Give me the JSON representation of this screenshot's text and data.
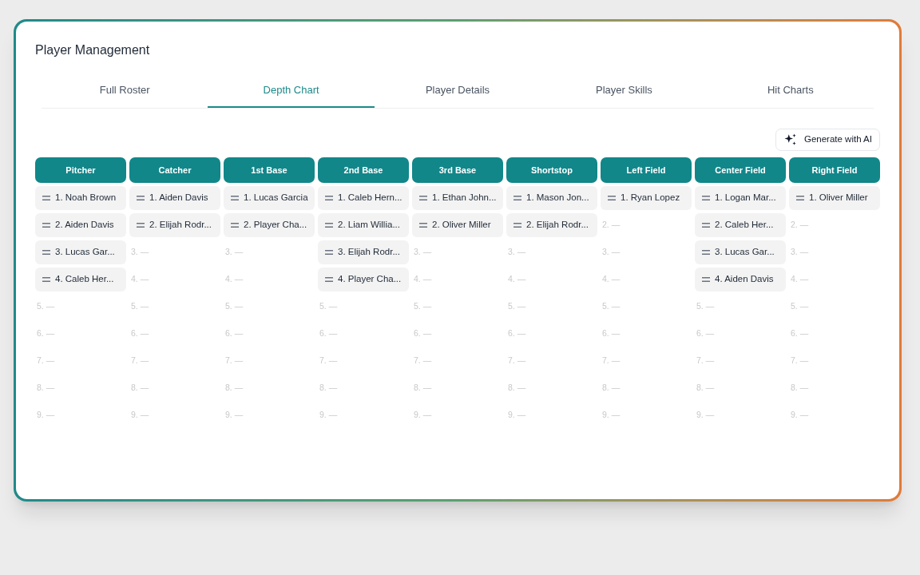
{
  "title": "Player Management",
  "tabs": [
    {
      "label": "Full Roster",
      "selected": false
    },
    {
      "label": "Depth Chart",
      "selected": true
    },
    {
      "label": "Player Details",
      "selected": false
    },
    {
      "label": "Player Skills",
      "selected": false
    },
    {
      "label": "Hit Charts",
      "selected": false
    }
  ],
  "generate_button": {
    "label": "Generate with AI"
  },
  "columns": [
    {
      "position": "Pitcher",
      "slots": [
        {
          "text": "1. Noah Brown",
          "filled": true
        },
        {
          "text": "2. Aiden Davis",
          "filled": true
        },
        {
          "text": "3. Lucas Gar...",
          "filled": true
        },
        {
          "text": "4. Caleb Her...",
          "filled": true
        },
        {
          "text": "5. —",
          "filled": false
        },
        {
          "text": "6. —",
          "filled": false
        },
        {
          "text": "7. —",
          "filled": false
        },
        {
          "text": "8. —",
          "filled": false
        },
        {
          "text": "9. —",
          "filled": false
        }
      ]
    },
    {
      "position": "Catcher",
      "slots": [
        {
          "text": "1. Aiden Davis",
          "filled": true
        },
        {
          "text": "2. Elijah Rodr...",
          "filled": true
        },
        {
          "text": "3. —",
          "filled": false
        },
        {
          "text": "4. —",
          "filled": false
        },
        {
          "text": "5. —",
          "filled": false
        },
        {
          "text": "6. —",
          "filled": false
        },
        {
          "text": "7. —",
          "filled": false
        },
        {
          "text": "8. —",
          "filled": false
        },
        {
          "text": "9. —",
          "filled": false
        }
      ]
    },
    {
      "position": "1st Base",
      "slots": [
        {
          "text": "1. Lucas Garcia",
          "filled": true
        },
        {
          "text": "2. Player Cha...",
          "filled": true
        },
        {
          "text": "3. —",
          "filled": false
        },
        {
          "text": "4. —",
          "filled": false
        },
        {
          "text": "5. —",
          "filled": false
        },
        {
          "text": "6. —",
          "filled": false
        },
        {
          "text": "7. —",
          "filled": false
        },
        {
          "text": "8. —",
          "filled": false
        },
        {
          "text": "9. —",
          "filled": false
        }
      ]
    },
    {
      "position": "2nd Base",
      "slots": [
        {
          "text": "1. Caleb Hern...",
          "filled": true
        },
        {
          "text": "2. Liam Willia...",
          "filled": true
        },
        {
          "text": "3. Elijah Rodr...",
          "filled": true
        },
        {
          "text": "4. Player Cha...",
          "filled": true
        },
        {
          "text": "5. —",
          "filled": false
        },
        {
          "text": "6. —",
          "filled": false
        },
        {
          "text": "7. —",
          "filled": false
        },
        {
          "text": "8. —",
          "filled": false
        },
        {
          "text": "9. —",
          "filled": false
        }
      ]
    },
    {
      "position": "3rd Base",
      "slots": [
        {
          "text": "1. Ethan John...",
          "filled": true
        },
        {
          "text": "2. Oliver Miller",
          "filled": true
        },
        {
          "text": "3. —",
          "filled": false
        },
        {
          "text": "4. —",
          "filled": false
        },
        {
          "text": "5. —",
          "filled": false
        },
        {
          "text": "6. —",
          "filled": false
        },
        {
          "text": "7. —",
          "filled": false
        },
        {
          "text": "8. —",
          "filled": false
        },
        {
          "text": "9. —",
          "filled": false
        }
      ]
    },
    {
      "position": "Shortstop",
      "slots": [
        {
          "text": "1. Mason Jon...",
          "filled": true
        },
        {
          "text": "2. Elijah Rodr...",
          "filled": true
        },
        {
          "text": "3. —",
          "filled": false
        },
        {
          "text": "4. —",
          "filled": false
        },
        {
          "text": "5. —",
          "filled": false
        },
        {
          "text": "6. —",
          "filled": false
        },
        {
          "text": "7. —",
          "filled": false
        },
        {
          "text": "8. —",
          "filled": false
        },
        {
          "text": "9. —",
          "filled": false
        }
      ]
    },
    {
      "position": "Left Field",
      "slots": [
        {
          "text": "1. Ryan Lopez",
          "filled": true
        },
        {
          "text": "2. —",
          "filled": false
        },
        {
          "text": "3. —",
          "filled": false
        },
        {
          "text": "4. —",
          "filled": false
        },
        {
          "text": "5. —",
          "filled": false
        },
        {
          "text": "6. —",
          "filled": false
        },
        {
          "text": "7. —",
          "filled": false
        },
        {
          "text": "8. —",
          "filled": false
        },
        {
          "text": "9. —",
          "filled": false
        }
      ]
    },
    {
      "position": "Center Field",
      "slots": [
        {
          "text": "1. Logan Mar...",
          "filled": true
        },
        {
          "text": "2. Caleb Her...",
          "filled": true
        },
        {
          "text": "3. Lucas Gar...",
          "filled": true
        },
        {
          "text": "4. Aiden Davis",
          "filled": true
        },
        {
          "text": "5. —",
          "filled": false
        },
        {
          "text": "6. —",
          "filled": false
        },
        {
          "text": "7. —",
          "filled": false
        },
        {
          "text": "8. —",
          "filled": false
        },
        {
          "text": "9. —",
          "filled": false
        }
      ]
    },
    {
      "position": "Right Field",
      "slots": [
        {
          "text": "1. Oliver Miller",
          "filled": true
        },
        {
          "text": "2. —",
          "filled": false
        },
        {
          "text": "3. —",
          "filled": false
        },
        {
          "text": "4. —",
          "filled": false
        },
        {
          "text": "5. —",
          "filled": false
        },
        {
          "text": "6. —",
          "filled": false
        },
        {
          "text": "7. —",
          "filled": false
        },
        {
          "text": "8. —",
          "filled": false
        },
        {
          "text": "9. —",
          "filled": false
        }
      ]
    }
  ]
}
